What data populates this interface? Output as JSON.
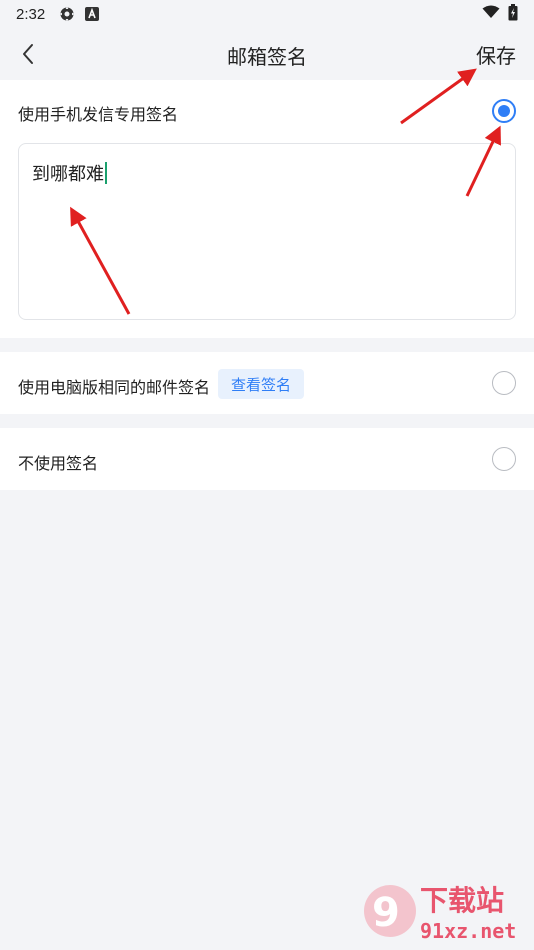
{
  "status_bar": {
    "time": "2:32",
    "icons": [
      "settings-gear-icon",
      "accessibility-a-icon",
      "wifi-icon",
      "battery-icon"
    ]
  },
  "header": {
    "back_icon": "chevron-left-icon",
    "title": "邮箱签名",
    "save_label": "保存"
  },
  "options": [
    {
      "label": "使用手机发信专用签名",
      "checked": true,
      "signature_text": "到哪都难"
    },
    {
      "label": "使用电脑版相同的邮件签名",
      "checked": false,
      "action_label": "查看签名"
    },
    {
      "label": "不使用签名",
      "checked": false
    }
  ],
  "watermark": {
    "logo_text": "下载站",
    "url_text": "91xz.net"
  },
  "colors": {
    "accent": "#2f7ef6",
    "background": "#f3f4f7",
    "arrow": "#e02020"
  }
}
